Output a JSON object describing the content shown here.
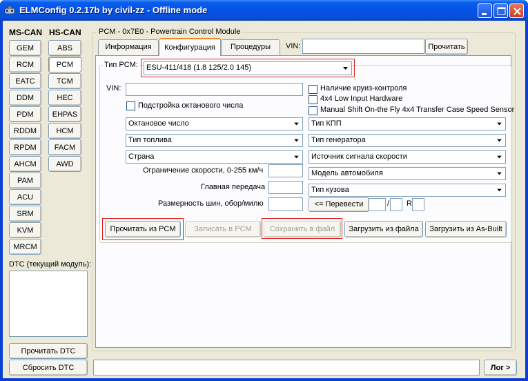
{
  "window": {
    "title": "ELMConfig 0.2.17b by civil-zz - Offline mode"
  },
  "modules": {
    "ms_header": "MS-CAN",
    "hs_header": "HS-CAN",
    "ms_can": [
      "GEM",
      "RCM",
      "EATC",
      "DDM",
      "PDM",
      "RDDM",
      "RPDM",
      "AHCM",
      "PAM",
      "ACU",
      "SRM",
      "KVM",
      "MRCM"
    ],
    "hs_can": [
      "ABS",
      "PCM",
      "TCM",
      "HEC",
      "EHPAS",
      "HCM",
      "FACM",
      "AWD"
    ],
    "selected": "PCM"
  },
  "dtc": {
    "label": "DTC (текущий модуль):",
    "read_button": "Прочитать DTC",
    "reset_button": "Сбросить DTC"
  },
  "log_button": "Лог >",
  "pcm": {
    "group_title": "PCM - 0x7E0 - Powertrain Control Module",
    "tabs": [
      "Информация",
      "Конфигурация",
      "Процедуры"
    ],
    "active_tab": "Конфигурация",
    "vin_label": "VIN:",
    "read_vin_button": "Прочитать",
    "type_group_label": "Тип PCM:",
    "type_value": "ESU-411/418 (1.8 125/2.0 145)",
    "config": {
      "vin_label": "VIN:",
      "octane_tuning_label": "Подстройка октанового числа",
      "cruise_label": "Наличие круиз-контроля",
      "low_input_label": "4x4 Low Input Hardware",
      "manual_shift_label": "Manual Shift On-the Fly 4x4 Transfer Case Speed Sensor",
      "combos_left": [
        "Октановое число",
        "Тип топлива",
        "Страна"
      ],
      "combos_right": [
        "Тип КПП",
        "Тип генератора",
        "Источник сигнала скорости",
        "Модель автомобиля",
        "Тип кузова"
      ],
      "speed_limit_label": "Ограничение скорости, 0-255 км/ч",
      "main_gear_label": "Главная передача",
      "tire_size_label": "Размерность шин, обор/милю",
      "convert_button": "<= Перевести",
      "slash": "/",
      "r_label": "R"
    },
    "actions": {
      "read": "Прочитать из PCM",
      "write": "Записать в PCM",
      "save": "Сохранить в файл",
      "load_file": "Загрузить из файла",
      "load_asbuilt": "Загрузить из As-Built"
    }
  },
  "colors": {
    "titlebar": "#0453e6",
    "highlight": "#e0201b",
    "tab_accent": "#e68b2c",
    "face": "#ece9d8"
  }
}
